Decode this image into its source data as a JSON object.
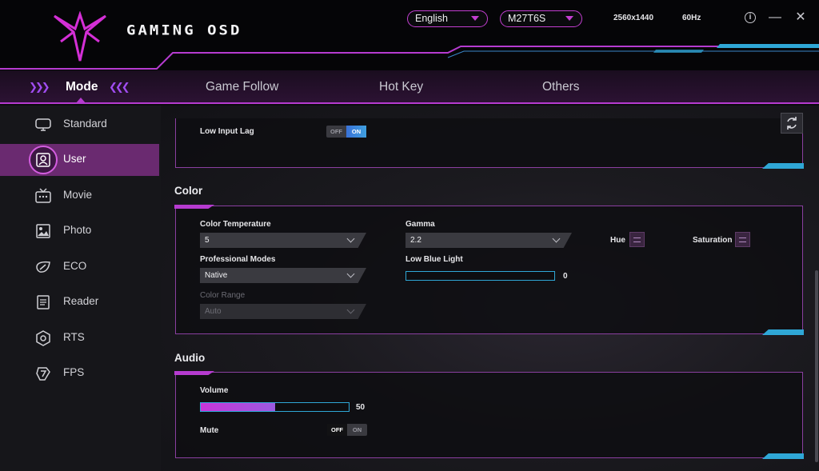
{
  "header": {
    "brand": "GAMING OSD",
    "language": "English",
    "model": "M27T6S",
    "resolution": "2560x1440",
    "refresh_rate": "60Hz",
    "accent": "#c23ed0",
    "icons": [
      "logo-icon",
      "info-icon",
      "minimize-icon",
      "close-icon"
    ]
  },
  "nav": {
    "tabs": [
      {
        "label": "Mode",
        "active": true
      },
      {
        "label": "Game Follow"
      },
      {
        "label": "Hot Key"
      },
      {
        "label": "Others"
      }
    ]
  },
  "sidebar": {
    "items": [
      {
        "label": "Standard",
        "icon": "monitor-icon"
      },
      {
        "label": "User",
        "icon": "user-icon",
        "active": true
      },
      {
        "label": "Movie",
        "icon": "tv-icon"
      },
      {
        "label": "Photo",
        "icon": "image-icon"
      },
      {
        "label": "ECO",
        "icon": "eco-icon"
      },
      {
        "label": "Reader",
        "icon": "book-icon"
      },
      {
        "label": "RTS",
        "icon": "hexagon-icon"
      },
      {
        "label": "FPS",
        "icon": "target-icon"
      }
    ]
  },
  "general": {
    "low_input_lag_label": "Low Input Lag",
    "low_input_lag": {
      "off": "OFF",
      "on": "ON",
      "state": "on"
    }
  },
  "color": {
    "title": "Color",
    "color_temperature_label": "Color Temperature",
    "color_temperature": "5",
    "professional_modes_label": "Professional Modes",
    "professional_modes": "Native",
    "color_range_label": "Color Range",
    "color_range": "Auto",
    "gamma_label": "Gamma",
    "gamma": "2.2",
    "low_blue_light_label": "Low Blue Light",
    "low_blue_light": 0,
    "hue_label": "Hue",
    "saturation_label": "Saturation"
  },
  "audio": {
    "title": "Audio",
    "volume_label": "Volume",
    "volume": 50,
    "mute_label": "Mute",
    "mute": {
      "off": "OFF",
      "on": "ON",
      "state": "off"
    }
  }
}
